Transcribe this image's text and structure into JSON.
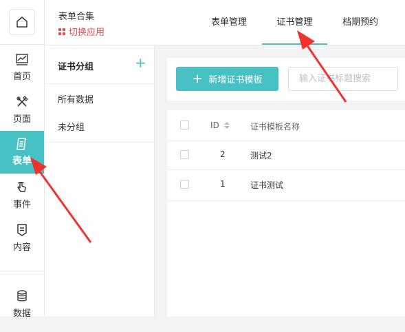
{
  "rail": {
    "home_icon": "home-icon",
    "items": [
      {
        "label": "首页",
        "icon": "chart-icon"
      },
      {
        "label": "页面",
        "icon": "design-icon"
      },
      {
        "label": "表单",
        "icon": "form-icon",
        "active": true
      },
      {
        "label": "事件",
        "icon": "touch-icon"
      },
      {
        "label": "内容",
        "icon": "content-icon"
      },
      {
        "label": "数据",
        "icon": "database-icon"
      }
    ]
  },
  "header": {
    "app_title": "表单合集",
    "switch_app": "切换应用",
    "tabs": [
      {
        "label": "表单管理"
      },
      {
        "label": "证书管理",
        "active": true
      },
      {
        "label": "档期预约"
      }
    ]
  },
  "group_panel": {
    "title": "证书分组",
    "add_icon": "plus-icon",
    "items": [
      "所有数据",
      "未分组"
    ]
  },
  "toolbar": {
    "add_button": "新增证书模板",
    "search_placeholder": "输入证书标题搜索"
  },
  "table": {
    "columns": [
      "ID",
      "证书模板名称"
    ],
    "rows": [
      {
        "id": "2",
        "name": "测试2"
      },
      {
        "id": "1",
        "name": "证书测试"
      }
    ]
  },
  "colors": {
    "accent": "#48c1c4",
    "switch_app": "#f04a4a",
    "annotation_arrow": "#f0332c"
  }
}
